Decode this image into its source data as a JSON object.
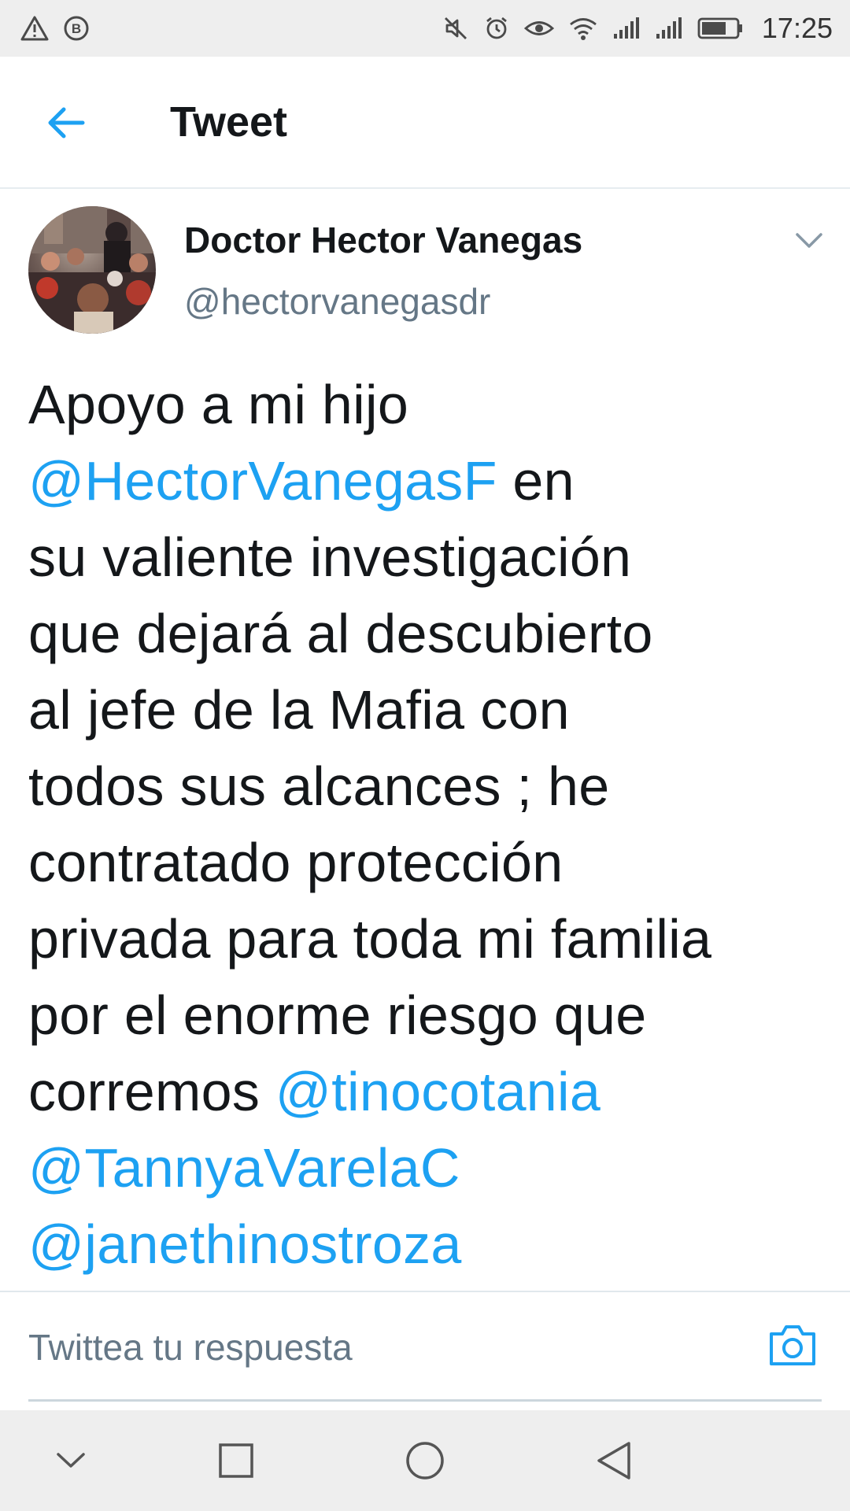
{
  "status_bar": {
    "time": "17:25",
    "icons_left": [
      "warning-icon",
      "b-badge-icon"
    ],
    "icons_right": [
      "mute-icon",
      "alarm-icon",
      "eye-icon",
      "wifi-icon",
      "signal-icon",
      "signal-icon",
      "battery-icon"
    ]
  },
  "app_bar": {
    "title": "Tweet",
    "back_icon": "arrow-left-icon"
  },
  "tweet": {
    "display_name": "Doctor Hector Vanegas",
    "handle": "@hectorvanegasdr",
    "lines": [
      {
        "text": "Apoyo a mi hijo"
      },
      {
        "mention": "@HectorVanegasF",
        "text": " en"
      },
      {
        "text": "su valiente investigación"
      },
      {
        "text": "que dejará al descubierto"
      },
      {
        "text": "al jefe de la Mafia con"
      },
      {
        "text": "todos sus alcances ; he"
      },
      {
        "text": "contratado protección"
      },
      {
        "text": "privada para toda mi familia"
      },
      {
        "text": "por el enorme riesgo que"
      },
      {
        "text": "corremos ",
        "mention": "@tinocotania"
      },
      {
        "mention": "@TannyaVarelaC"
      },
      {
        "mention": "@janethinostroza"
      }
    ]
  },
  "reply": {
    "placeholder": "Twittea tu respuesta",
    "camera_icon": "camera-icon"
  },
  "nav_bar": {
    "icons": [
      "chevron-down-icon",
      "square-icon",
      "circle-icon",
      "triangle-back-icon"
    ]
  },
  "colors": {
    "accent": "#1da1f2",
    "text": "#14171a",
    "secondary": "#657786",
    "system_bar": "#eeeeee"
  }
}
